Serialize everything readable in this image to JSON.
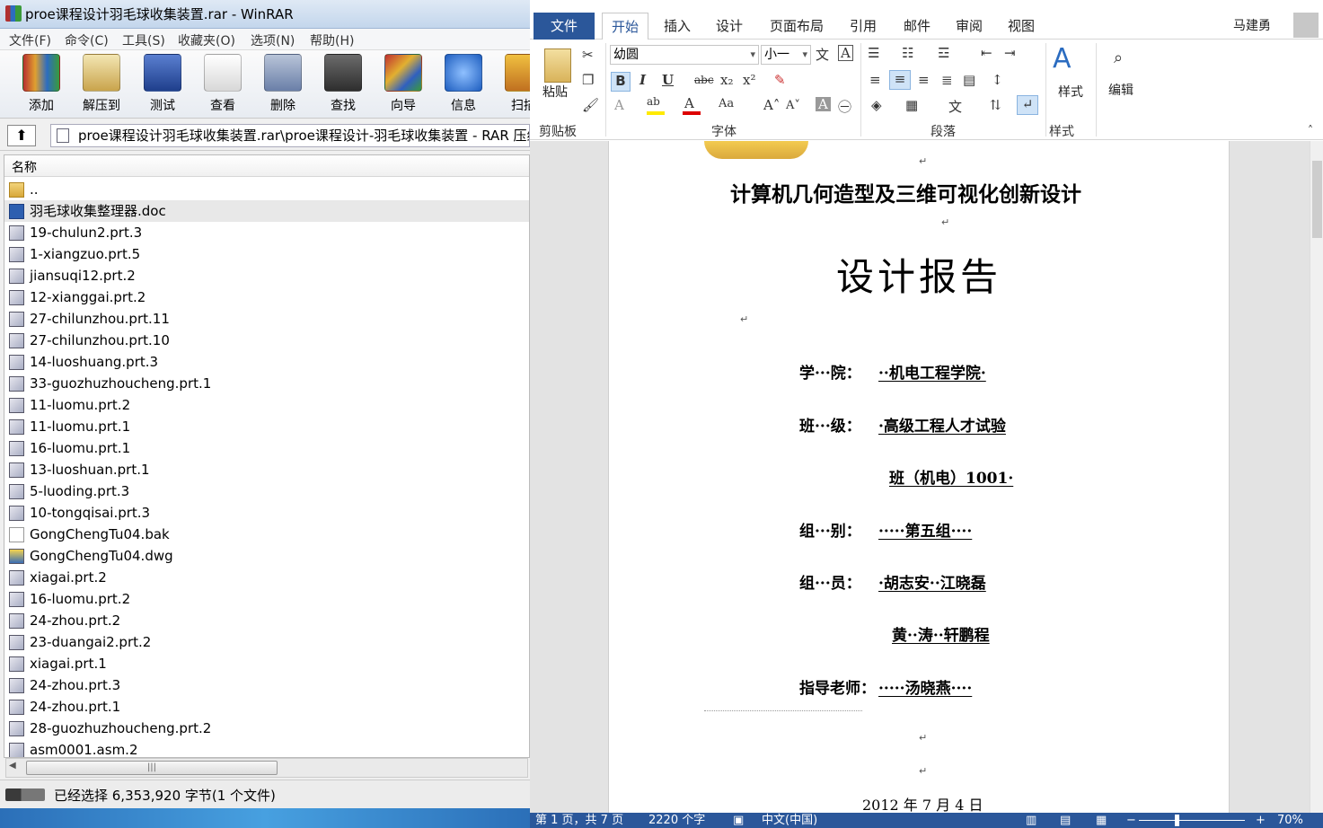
{
  "winrar": {
    "title": "proe课程设计羽毛球收集装置.rar - WinRAR",
    "menu": [
      "文件(F)",
      "命令(C)",
      "工具(S)",
      "收藏夹(O)",
      "选项(N)",
      "帮助(H)"
    ],
    "toolbar": [
      "添加",
      "解压到",
      "测试",
      "查看",
      "删除",
      "查找",
      "向导",
      "信息",
      "扫描"
    ],
    "path": "proe课程设计羽毛球收集装置.rar\\proe课程设计-羽毛球收集装置 - RAR 压缩",
    "column_name": "名称",
    "files": [
      {
        "name": "..",
        "type": "folder"
      },
      {
        "name": "羽毛球收集整理器.doc",
        "type": "doc"
      },
      {
        "name": "19-chulun2.prt.3",
        "type": "prt"
      },
      {
        "name": "1-xiangzuo.prt.5",
        "type": "prt"
      },
      {
        "name": "jiansuqi12.prt.2",
        "type": "prt"
      },
      {
        "name": "12-xianggai.prt.2",
        "type": "prt"
      },
      {
        "name": "27-chilunzhou.prt.11",
        "type": "prt"
      },
      {
        "name": "27-chilunzhou.prt.10",
        "type": "prt"
      },
      {
        "name": "14-luoshuang.prt.3",
        "type": "prt"
      },
      {
        "name": "33-guozhuzhoucheng.prt.1",
        "type": "prt"
      },
      {
        "name": "11-luomu.prt.2",
        "type": "prt"
      },
      {
        "name": "11-luomu.prt.1",
        "type": "prt"
      },
      {
        "name": "16-luomu.prt.1",
        "type": "prt"
      },
      {
        "name": "13-luoshuan.prt.1",
        "type": "prt"
      },
      {
        "name": "5-luoding.prt.3",
        "type": "prt"
      },
      {
        "name": "10-tongqisai.prt.3",
        "type": "prt"
      },
      {
        "name": "GongChengTu04.bak",
        "type": "bak"
      },
      {
        "name": "GongChengTu04.dwg",
        "type": "dwg"
      },
      {
        "name": "xiagai.prt.2",
        "type": "prt"
      },
      {
        "name": "16-luomu.prt.2",
        "type": "prt"
      },
      {
        "name": "24-zhou.prt.2",
        "type": "prt"
      },
      {
        "name": "23-duangai2.prt.2",
        "type": "prt"
      },
      {
        "name": "xiagai.prt.1",
        "type": "prt"
      },
      {
        "name": "24-zhou.prt.3",
        "type": "prt"
      },
      {
        "name": "24-zhou.prt.1",
        "type": "prt"
      },
      {
        "name": "28-guozhuzhoucheng.prt.2",
        "type": "prt"
      },
      {
        "name": "asm0001.asm.2",
        "type": "prt"
      }
    ],
    "status": "已经选择 6,353,920 字节(1 个文件)"
  },
  "word": {
    "tabs": {
      "file": "文件",
      "home": "开始",
      "insert": "插入",
      "design": "设计",
      "layout": "页面布局",
      "references": "引用",
      "mailings": "邮件",
      "review": "审阅",
      "view": "视图"
    },
    "user": "马建勇",
    "ribbon": {
      "paste": "粘贴",
      "clipboard": "剪贴板",
      "font_name": "幼圆",
      "font_size": "小一",
      "font_group": "字体",
      "paragraph_group": "段落",
      "styles": "样式",
      "styles_group": "样式",
      "edit": "编辑"
    },
    "document": {
      "title": "计算机几何造型及三维可视化创新设计",
      "report": "设计报告",
      "college_label": "学···院：",
      "college": "··机电工程学院·",
      "class_label": "班···级：",
      "class_line1": "·高级工程人才试验",
      "class_line2": "班（机电）1001·",
      "group_label": "组···别：",
      "group": "·····第五组····",
      "members_label": "组···员：",
      "members1": "·胡志安··江晓磊",
      "members2": "黄··涛··轩鹏程",
      "teacher_label": "指导老师：",
      "teacher": "·····汤晓燕····",
      "date": "2012 年 7 月 4 日"
    },
    "status": {
      "page": "第 1 页，共 7 页",
      "words": "2220 个字",
      "lang": "中文(中国)",
      "zoom": "70%"
    }
  }
}
